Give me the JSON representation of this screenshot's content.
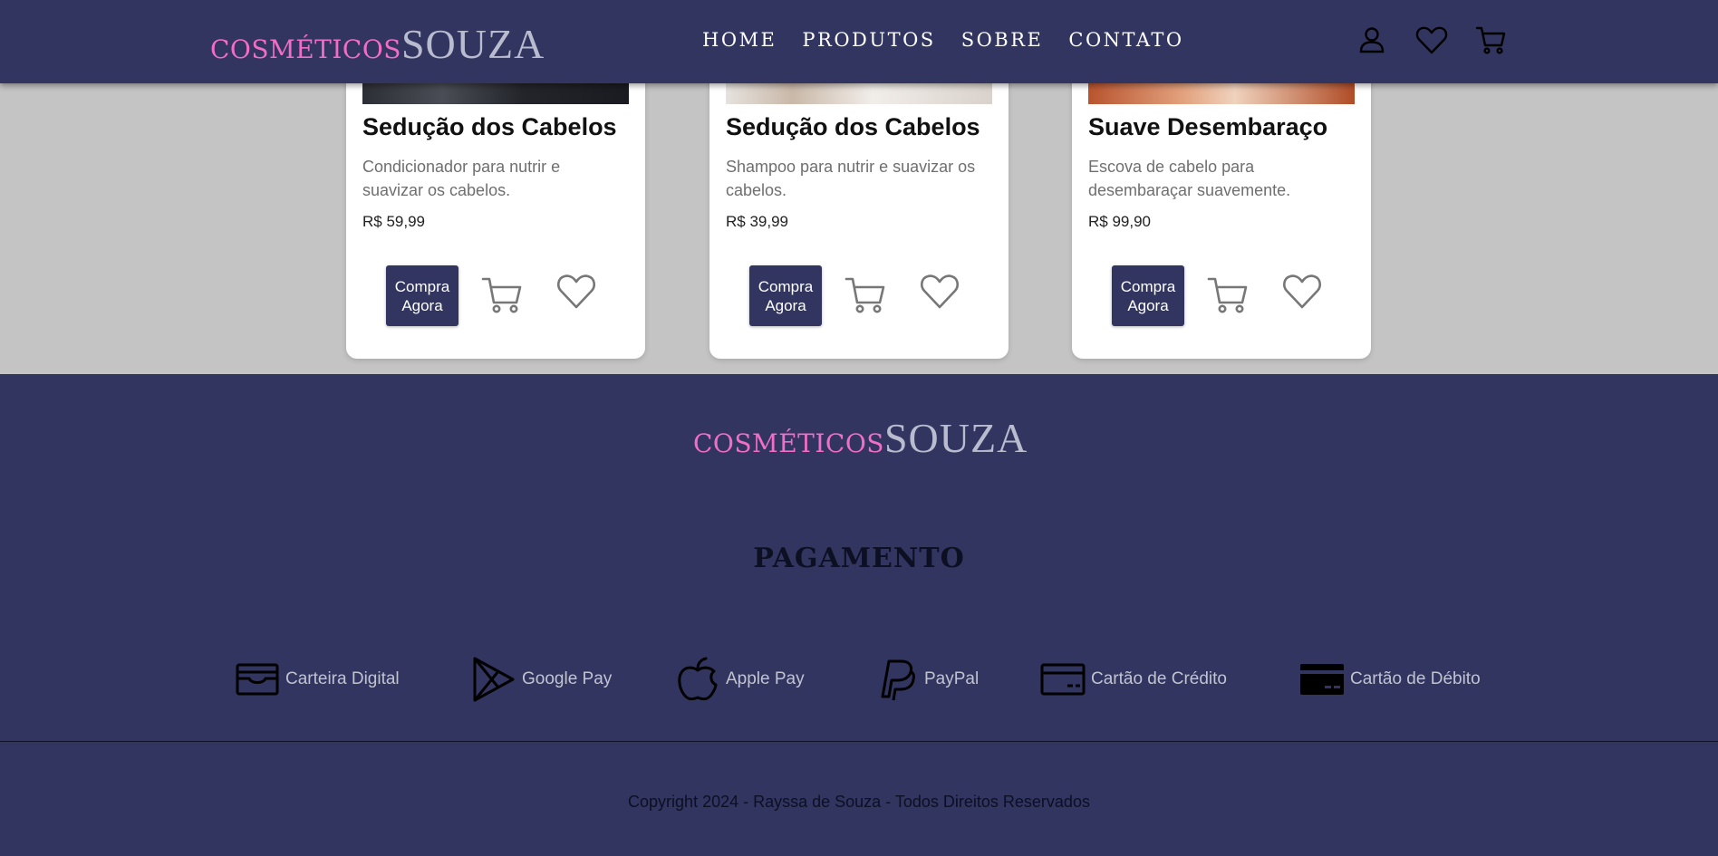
{
  "header": {
    "logo_small": "COSMÉTICOS",
    "logo_big": "SOUZA",
    "nav": [
      "Home",
      "Produtos",
      "Sobre",
      "Contato"
    ],
    "icons": [
      "user-icon",
      "heart-icon",
      "cart-icon"
    ]
  },
  "products": [
    {
      "title": "Sedução dos Cabelos",
      "description": "Condicionador para nutrir e suavizar os cabelos.",
      "price": "R$ 59,99",
      "button": "Compra Agora"
    },
    {
      "title": "Sedução dos Cabelos",
      "description": "Shampoo para nutrir e suavizar os cabelos.",
      "price": "R$ 39,99",
      "button": "Compra Agora"
    },
    {
      "title": "Suave Desembaraço",
      "description": "Escova de cabelo para desembaraçar suavemente.",
      "price": "R$ 99,90",
      "button": "Compra Agora"
    }
  ],
  "footer": {
    "logo_small": "COSMÉTICOS",
    "logo_big": "SOUZA",
    "payment_title": "Pagamento",
    "payments": [
      {
        "label": "Carteira Digital",
        "icon": "wallet-icon"
      },
      {
        "label": "Google Pay",
        "icon": "google-play-icon"
      },
      {
        "label": "Apple Pay",
        "icon": "apple-icon"
      },
      {
        "label": "PayPal",
        "icon": "paypal-icon"
      },
      {
        "label": "Cartão de Crédito",
        "icon": "credit-card-icon"
      },
      {
        "label": "Cartão de Débito",
        "icon": "debit-card-icon"
      }
    ],
    "copyright": "Copyright 2024 - Rayssa de Souza - Todos Direitos Reservados"
  },
  "colors": {
    "primary": "#31355f",
    "accent_pink": "#f06ec7",
    "page_background": "#c4c4c4"
  }
}
